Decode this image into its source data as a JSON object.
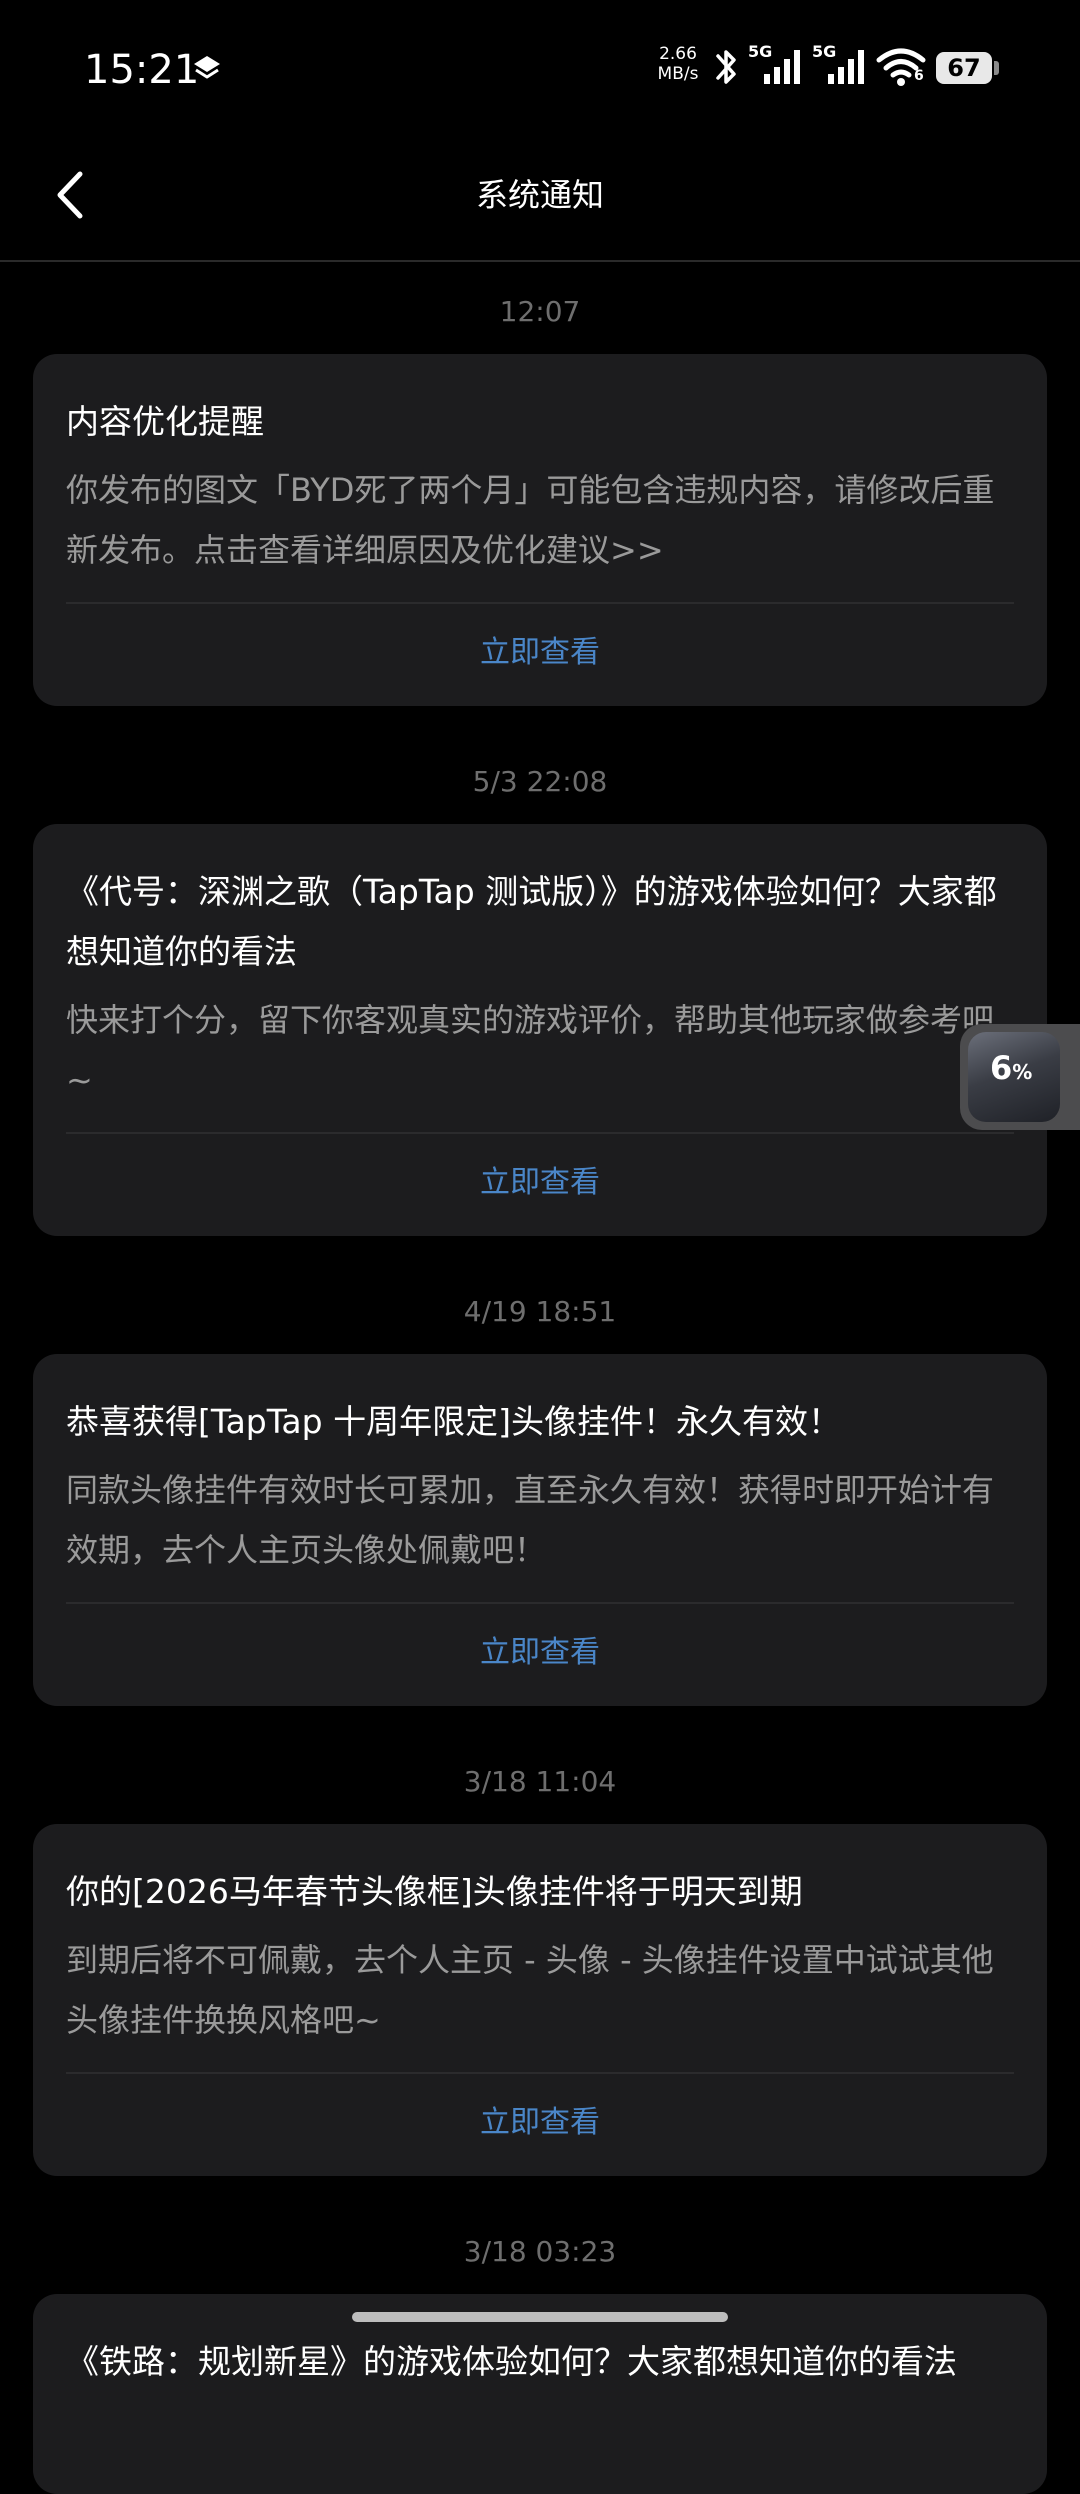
{
  "status_bar": {
    "time": "15:21",
    "net_speed_value": "2.66",
    "net_speed_unit": "MB/s",
    "signal1_label": "5G",
    "signal2_label": "5G",
    "wifi_label": "6",
    "battery": "67"
  },
  "nav": {
    "title": "系统通知",
    "back_icon": "chevron-left-icon"
  },
  "notifications": [
    {
      "time": "12:07",
      "title": "内容优化提醒",
      "body": "你发布的图文「BYD死了两个月」可能包含违规内容，请修改后重新发布。点击查看详细原因及优化建议>>",
      "action": "立即查看"
    },
    {
      "time": "5/3  22:08",
      "title": "《代号：深渊之歌（TapTap 测试版）》的游戏体验如何？大家都想知道你的看法",
      "body": "快来打个分，留下你客观真实的游戏评价，帮助其他玩家做参考吧 ~",
      "action": "立即查看"
    },
    {
      "time": "4/19  18:51",
      "title": "恭喜获得[TapTap 十周年限定]头像挂件！永久有效！",
      "body": "同款头像挂件有效时长可累加，直至永久有效！获得时即开始计有效期，去个人主页头像处佩戴吧！",
      "action": "立即查看"
    },
    {
      "time": "3/18  11:04",
      "title": "你的[2026马年春节头像框]头像挂件将于明天到期",
      "body": "到期后将不可佩戴，去个人主页 - 头像 - 头像挂件设置中试试其他头像挂件换换风格吧~",
      "action": "立即查看"
    },
    {
      "time": "3/18  03:23",
      "title": "《铁路：规划新星》的游戏体验如何？大家都想知道你的看法",
      "body": "",
      "action": ""
    }
  ],
  "float_widget": {
    "value": "6",
    "unit": "%"
  },
  "colors": {
    "background": "#000000",
    "card": "#1c1c1e",
    "action": "#4a86c8",
    "timestamp": "#6e6e6e",
    "body_text": "#9a9a9a"
  }
}
